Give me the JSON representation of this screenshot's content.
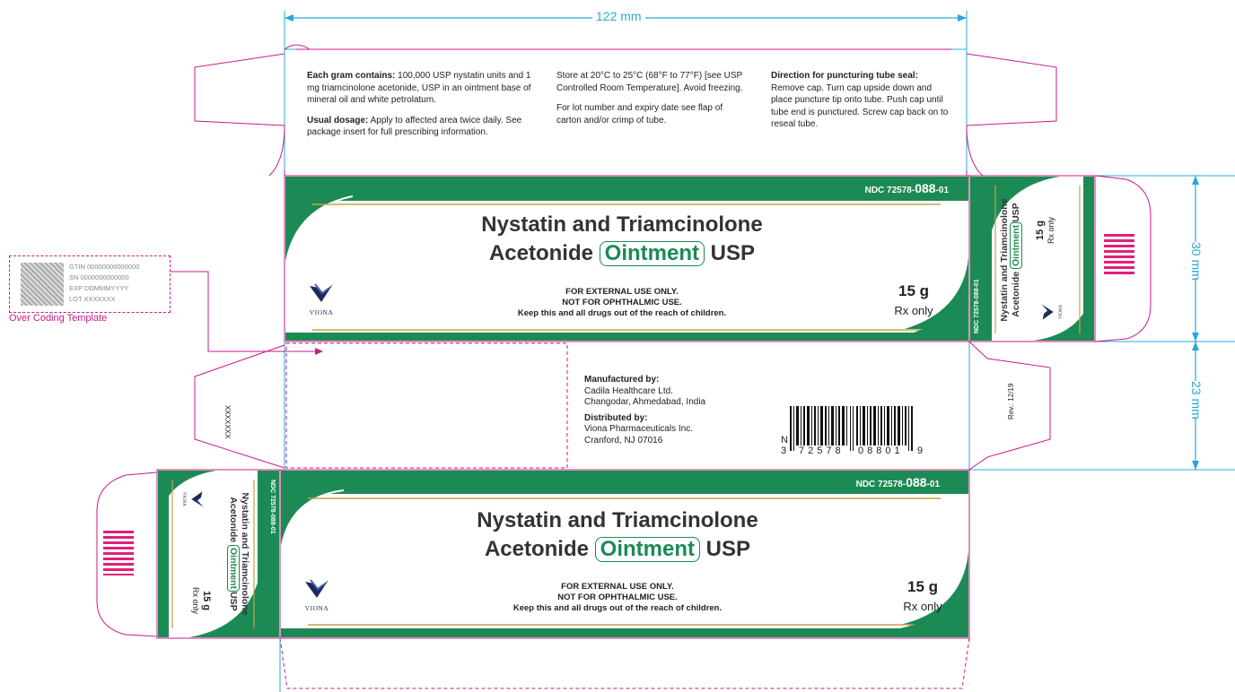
{
  "dimensions": {
    "width_label": "122 mm",
    "height_label": "30 mm",
    "depth_label": "23 mm"
  },
  "top_panel": {
    "col1_p1_bold": "Each gram contains:",
    "col1_p1_rest": "100,000 USP nystatin units and 1 mg triamcinolone acetonide, USP in an ointment base of mineral oil and white petrolatum.",
    "col1_p2_bold": "Usual dosage:",
    "col1_p2_rest": "Apply to affected area twice daily. See package insert for full prescribing information.",
    "col2_p1": "Store at 20°C to 25°C (68°F to 77°F) [see USP Controlled Room Temperature]. Avoid freezing.",
    "col2_p2": "For lot number and expiry date see flap of carton and/or crimp of tube.",
    "col3_title": "Direction for puncturing tube seal:",
    "col3_body": "Remove cap. Turn cap upside down and place puncture tip onto tube. Push cap until tube end is punctured. Screw cap back on to reseal tube."
  },
  "front": {
    "ndc_prefix": "NDC 72578-",
    "ndc_mid": "088",
    "ndc_suffix": "-01",
    "title_line1": "Nystatin and Triamcinolone",
    "title_line2_pre": "Acetonide",
    "title_oint": "Ointment",
    "title_line2_post": "USP",
    "warn1": "FOR EXTERNAL USE ONLY.",
    "warn2": "NOT FOR OPHTHALMIC USE.",
    "warn3": "Keep this and all drugs out of the reach of children.",
    "qty": "15 g",
    "rx": "Rx only",
    "logo_text": "VIONA"
  },
  "side_panel": {
    "ndc": "NDC 72578-088-01",
    "title_line1": "Nystatin and Triamcinolone",
    "title_pre": "Acetonide",
    "title_oint": "Ointment",
    "title_post": "USP",
    "qty": "15 g",
    "rx": "Rx only",
    "logo_text": "VIONA"
  },
  "overcoding": {
    "gtin": "GTIN 00000000000000",
    "sn": "SN 0000000000000",
    "exp": "EXP DDMMMYYYY",
    "lot": "LOT XXXXXXX",
    "label": "Over Coding Template"
  },
  "back": {
    "manuf_title": "Manufactured by:",
    "manuf_line1": "Cadila Healthcare Ltd.",
    "manuf_line2": "Changodar, Ahmedabad, India",
    "dist_title": "Distributed by:",
    "dist_line1": "Viona Pharmaceuticals Inc.",
    "dist_line2": "Cranford, NJ 07016",
    "barcode_n": "N",
    "barcode_3": "3",
    "barcode_digits1": "72578",
    "barcode_digits2": "08801",
    "barcode_check": "9",
    "flap_code": "XXXXXXX",
    "rev": "Rev.: 12/19"
  },
  "colors": {
    "green": "#1c8a54",
    "magenta": "#c81b87",
    "cyan": "#29a8d8",
    "gold": "#c8a24a"
  }
}
